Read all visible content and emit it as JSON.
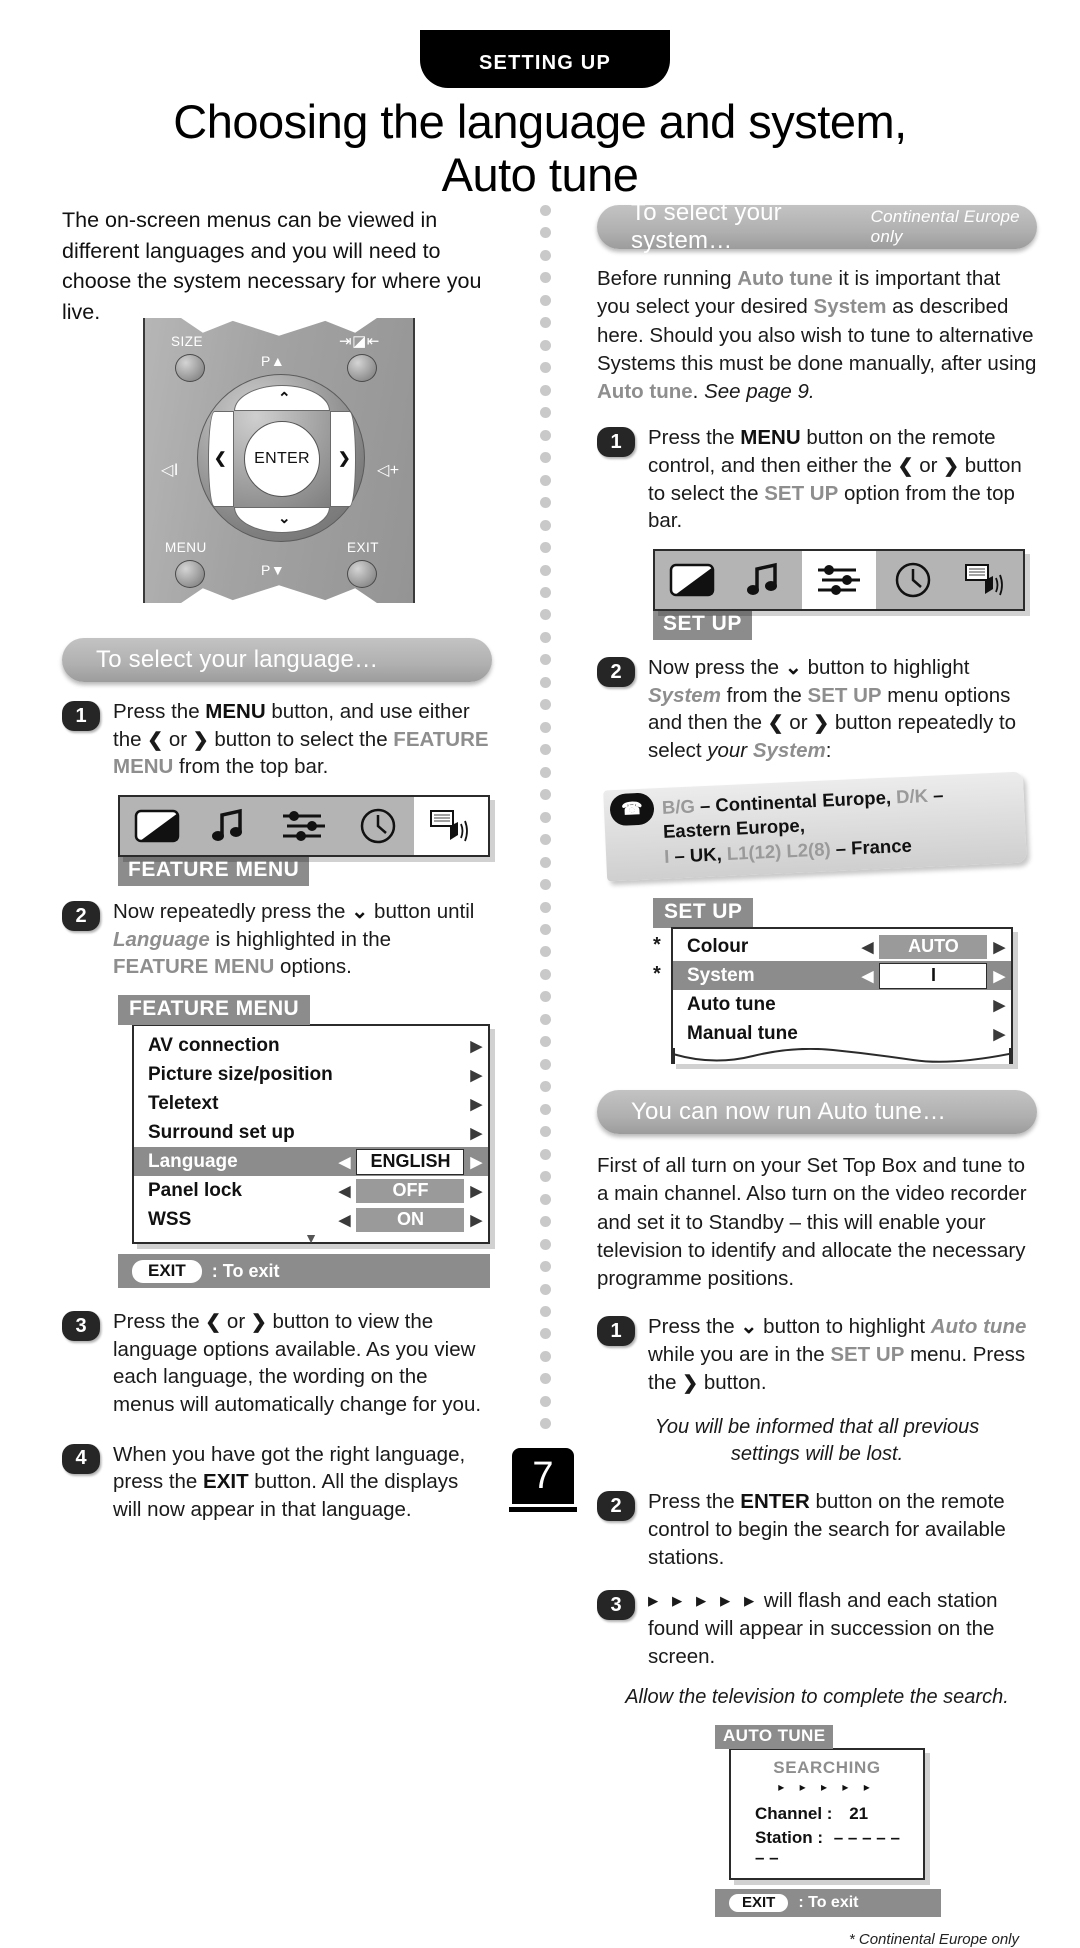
{
  "header": {
    "tab_label": "SETTING UP",
    "title_line1": "Choosing the language and system,",
    "title_line2": "Auto tune"
  },
  "left": {
    "intro": "The on-screen menus can be viewed in different languages and you will need to choose the system necessary for where you live.",
    "remote": {
      "size_label": "SIZE",
      "mute_label": "mute-icon",
      "p_up": "P",
      "p_down": "P",
      "menu_label": "MENU",
      "exit_label": "EXIT",
      "enter_label": "ENTER",
      "vol_down": "volume-down-icon",
      "vol_up": "volume-up-icon"
    },
    "section_title": "To select your language…",
    "step1": {
      "num": "1",
      "p1": "Press the ",
      "menu": "MENU",
      "p2": " button, and use either the ",
      "left_chev": "❮",
      "or": " or ",
      "right_chev": "❯",
      "p3": " button to select the ",
      "feature_menu": "FEATURE MENU",
      "p4": " from the top bar."
    },
    "icon_bar_tag": "FEATURE MENU",
    "step2": {
      "num": "2",
      "p1": "Now repeatedly press the ",
      "down": "⌄",
      "p2": " button until ",
      "language": "Language",
      "p3": " is highlighted in the ",
      "feature_menu": "FEATURE MENU",
      "p4": " options."
    },
    "feature_menu": {
      "tag": "FEATURE MENU",
      "rows": [
        {
          "label": "AV connection",
          "type": "arrow"
        },
        {
          "label": "Picture size/position",
          "type": "arrow"
        },
        {
          "label": "Teletext",
          "type": "arrow"
        },
        {
          "label": "Surround set up",
          "type": "arrow"
        },
        {
          "label": "Language",
          "type": "value",
          "value": "ENGLISH",
          "selected": true,
          "box": "white"
        },
        {
          "label": "Panel lock",
          "type": "value",
          "value": "OFF",
          "selected": false,
          "box": "grey"
        },
        {
          "label": "WSS",
          "type": "value",
          "value": "ON",
          "selected": false,
          "box": "grey"
        }
      ],
      "exit_chip": "EXIT",
      "exit_text": ": To exit"
    },
    "step3": {
      "num": "3",
      "p1": "Press the ",
      "left_chev": "❮",
      "or": " or ",
      "right_chev": "❯",
      "p2": " button to view the language options available. As you view each language, the wording on the menus will automatically change for you."
    },
    "step4": {
      "num": "4",
      "p1": "When you have got the right language, press the ",
      "exit": "EXIT",
      "p2": " button. All the displays will now appear in that language."
    }
  },
  "right": {
    "section_title_system": "To select your system…",
    "section_note_system": "Continental Europe only",
    "intro": {
      "p1": "Before running ",
      "auto_tune": "Auto tune",
      "p2": " it is important that you select your desired ",
      "system": "System",
      "p3": " as described here. Should you also wish to tune to alternative Systems this must be done manually, after using ",
      "auto_tune2": "Auto tune",
      "p4": ". ",
      "see_page": "See page 9."
    },
    "step1": {
      "num": "1",
      "p1": "Press the ",
      "menu": "MENU",
      "p2": " button on the remote control, and then either the ",
      "left_chev": "❮",
      "or": " or ",
      "right_chev": "❯",
      "p3": " button to select the ",
      "setup": "SET UP",
      "p4": " option from the top bar."
    },
    "icon_bar_tag": "SET UP",
    "step2": {
      "num": "2",
      "p1": "Now press the ",
      "down": "⌄",
      "p2": " button to highlight ",
      "system": "System",
      "p3": " from the ",
      "setup": "SET UP",
      "p4": " menu options and then the ",
      "left_chev": "❮",
      "or": " or ",
      "right_chev": "❯",
      "p5": " button repeatedly to select ",
      "your": "your ",
      "system2": "System",
      "p6": ":"
    },
    "sys_note": {
      "bg": "B/G",
      "bg_desc": " – Continental Europe, ",
      "dk": "D/K",
      "dk_desc": " – Eastern Europe,",
      "i_code": "I",
      "i_desc": " – UK, ",
      "l1": "L1(12)",
      "l2": " L2(8)",
      "l_desc": " – France"
    },
    "setup_menu": {
      "tag": "SET UP",
      "rows": [
        {
          "label": "Colour",
          "type": "value",
          "value": "AUTO",
          "selected": false,
          "box": "grey",
          "star": true
        },
        {
          "label": "System",
          "type": "value",
          "value": "I",
          "selected": true,
          "box": "white",
          "star": true
        },
        {
          "label": "Auto tune",
          "type": "arrow",
          "star": false
        },
        {
          "label": "Manual tune",
          "type": "arrow",
          "star": false
        }
      ]
    },
    "section_title_autotune": "You can now run Auto tune…",
    "autotune_intro": "First of all turn on your Set Top Box and tune to a main channel. Also turn on the video recorder and set it to Standby – this will enable your television to identify and allocate the necessary programme positions.",
    "at_step1": {
      "num": "1",
      "p1": "Press the ",
      "down": "⌄",
      "p2": " button to highlight ",
      "auto_tune": "Auto tune",
      "p3": " while you are in the ",
      "setup": "SET UP",
      "p4": " menu. Press the ",
      "right_chev": "❯",
      "p5": " button."
    },
    "note1_line1": "You will be informed that all previous",
    "note1_line2": "settings will be lost.",
    "at_step2": {
      "num": "2",
      "p1": "Press the ",
      "enter": "ENTER",
      "p2": " button on the remote control to begin the search for available stations."
    },
    "at_step3": {
      "num": "3",
      "triangles": "▸ ▸ ▸ ▸ ▸",
      "p1": " will flash and each station found will appear in succession on the screen."
    },
    "note2": "Allow the television to complete the search.",
    "auto_tune_panel": {
      "tag": "AUTO TUNE",
      "searching": "SEARCHING",
      "triangles": "▸ ▸ ▸ ▸ ▸",
      "channel_label": "Channel :",
      "channel_value": "21",
      "station_label": "Station  :",
      "station_value": "– – – – – – –",
      "exit_chip": "EXIT",
      "exit_text": ": To exit"
    },
    "footnote": "* Continental Europe only"
  },
  "footer": {
    "page_number": "7"
  },
  "colors": {
    "accent_grey": "#8e8e8e",
    "osd_tag_grey": "#8c8c8c",
    "black": "#000000"
  }
}
